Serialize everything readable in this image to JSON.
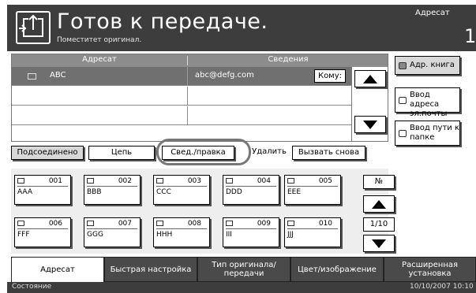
{
  "header": {
    "title": "Готов к передаче.",
    "subtitle": "Поместитет оригинал.",
    "right_label": "Адресат",
    "right_count": "1"
  },
  "table": {
    "columns": [
      "Адресат",
      "Сведения"
    ],
    "rows": [
      {
        "name": "ABC",
        "details": "abc@defg.com",
        "tag": "Кому:",
        "selected": true
      },
      {
        "name": "",
        "details": "",
        "tag": "",
        "selected": false
      },
      {
        "name": "",
        "details": "",
        "tag": "",
        "selected": false
      }
    ]
  },
  "side_buttons": {
    "address_book": "Адр. книга",
    "email_entry": "Ввод адреса эл.почты",
    "folder_entry": "Ввод пути к папке"
  },
  "actions": {
    "connected": "Подсоединено",
    "chain": "Цепь",
    "details_edit": "Свед./правка",
    "delete": "Удалить",
    "recall": "Вызвать снова"
  },
  "tiles": [
    {
      "num": "001",
      "name": "AAA",
      "icon": "envelope-icon"
    },
    {
      "num": "002",
      "name": "BBB",
      "icon": "envelope-icon"
    },
    {
      "num": "003",
      "name": "CCC",
      "icon": "envelope-icon"
    },
    {
      "num": "004",
      "name": "DDD",
      "icon": "envelope-icon"
    },
    {
      "num": "005",
      "name": "EEE",
      "icon": "envelope-icon"
    },
    {
      "num": "006",
      "name": "FFF",
      "icon": "folder-icon"
    },
    {
      "num": "007",
      "name": "GGG",
      "icon": "folder-icon"
    },
    {
      "num": "008",
      "name": "HHH",
      "icon": "folder-icon"
    },
    {
      "num": "009",
      "name": "III",
      "icon": "folder-icon"
    },
    {
      "num": "010",
      "name": "JJJ",
      "icon": "folder-icon"
    }
  ],
  "grid_controls": {
    "number": "№",
    "page": "1/10"
  },
  "tabs": [
    {
      "label": "Адресат",
      "active": true
    },
    {
      "label": "Быстрая настройка",
      "active": false
    },
    {
      "label": "Тип оригинала/ передачи",
      "active": false
    },
    {
      "label": "Цвет/изображение",
      "active": false
    },
    {
      "label": "Расширенная установка",
      "active": false
    }
  ],
  "status": {
    "left": "Состояние",
    "right": "10/10/2007 10:10"
  }
}
